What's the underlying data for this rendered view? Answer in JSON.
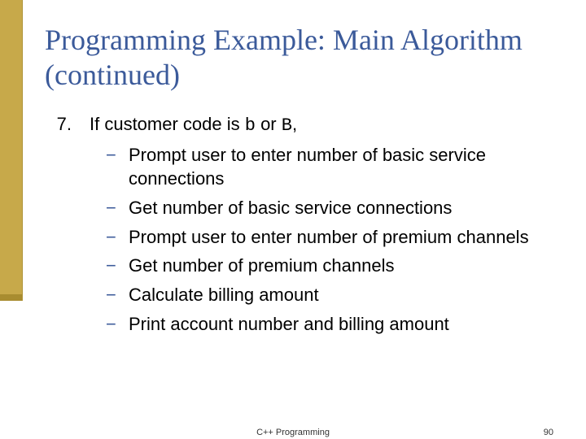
{
  "title": "Programming Example: Main Algorithm (continued)",
  "list": {
    "number": "7.",
    "text_prefix": "If customer code is ",
    "code1": "b",
    "mid": " or ",
    "code2": "B",
    "suffix": ","
  },
  "subitems": [
    "Prompt user to enter number of basic service connections",
    "Get number of basic service connections",
    "Prompt user to enter number of premium channels",
    "Get number of premium channels",
    "Calculate billing amount",
    "Print account number and billing amount"
  ],
  "footer": {
    "center": "C++ Programming",
    "page": "90"
  }
}
